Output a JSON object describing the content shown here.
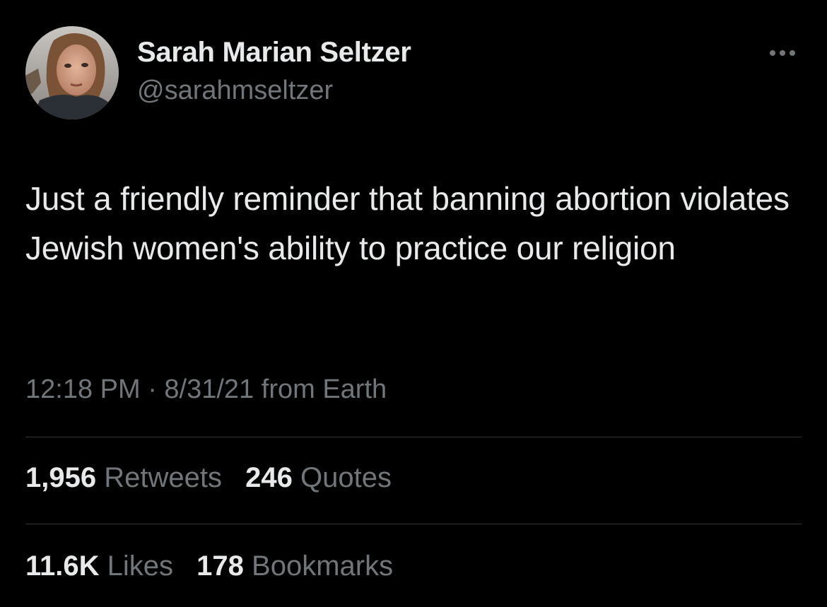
{
  "author": {
    "display_name": "Sarah Marian Seltzer",
    "handle": "@sarahmseltzer"
  },
  "more_icon": "more-horizontal-icon",
  "tweet": {
    "text": "Just a friendly reminder that banning abortion violates Jewish women's ability to practice our religion",
    "meta": "12:18 PM · 8/31/21 from Earth"
  },
  "stats": {
    "retweets": {
      "count": "1,956",
      "label": "Retweets"
    },
    "quotes": {
      "count": "246",
      "label": "Quotes"
    },
    "likes": {
      "count": "11.6K",
      "label": "Likes"
    },
    "bookmarks": {
      "count": "178",
      "label": "Bookmarks"
    }
  },
  "colors": {
    "background": "#000000",
    "primary_text": "#e7e9ea",
    "secondary_text": "#71767b",
    "divider": "#2f3336"
  }
}
